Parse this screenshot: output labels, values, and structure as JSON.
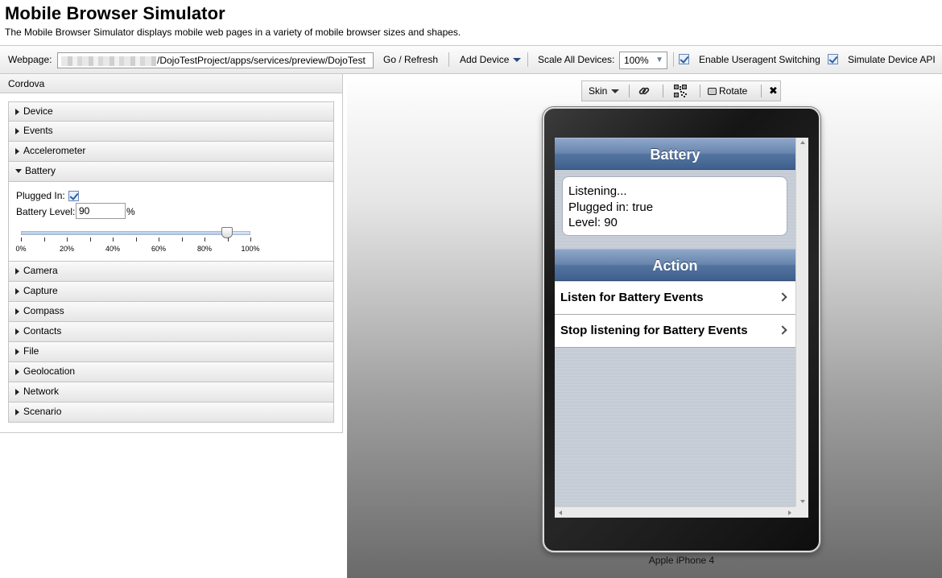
{
  "header": {
    "title": "Mobile Browser Simulator",
    "subtitle": "The Mobile Browser Simulator displays mobile web pages in a variety of mobile browser sizes and shapes."
  },
  "toolbar": {
    "webpage_label": "Webpage:",
    "url_value": "/DojoTestProject/apps/services/preview/DojoTest",
    "go_label": "Go / Refresh",
    "add_device_label": "Add Device",
    "scale_label": "Scale All Devices:",
    "scale_value": "100%",
    "useragent_label": "Enable Useragent Switching",
    "useragent_checked": true,
    "simulate_api_label": "Simulate Device API",
    "simulate_api_checked": true
  },
  "left_panel": {
    "title": "Cordova",
    "sections_before": [
      "Device",
      "Events",
      "Accelerometer"
    ],
    "expanded": {
      "name": "Battery",
      "plugged_label": "Plugged In:",
      "plugged_checked": true,
      "level_label": "Battery Level:",
      "level_value": "90",
      "level_unit": "%",
      "slider_value_percent": 90,
      "tick_labels": [
        "0%",
        "20%",
        "40%",
        "60%",
        "80%",
        "100%"
      ]
    },
    "sections_after": [
      "Camera",
      "Capture",
      "Compass",
      "Contacts",
      "File",
      "Geolocation",
      "Network",
      "Scenario"
    ]
  },
  "device_toolbar": {
    "skin_label": "Skin",
    "rotate_label": "Rotate",
    "icons": [
      "link-icon",
      "qr-code-icon",
      "rotate-icon",
      "close-icon"
    ]
  },
  "device": {
    "name": "Apple iPhone 4",
    "screen": {
      "heading_battery": "Battery",
      "status_lines": [
        "Listening...",
        "Plugged in: true",
        "Level: 90"
      ],
      "heading_action": "Action",
      "list_items": [
        "Listen for Battery Events",
        "Stop listening for Battery Events"
      ]
    }
  },
  "colors": {
    "header_bar_blue": "#5474a0",
    "checkbox_blue": "#2a5fa8"
  }
}
